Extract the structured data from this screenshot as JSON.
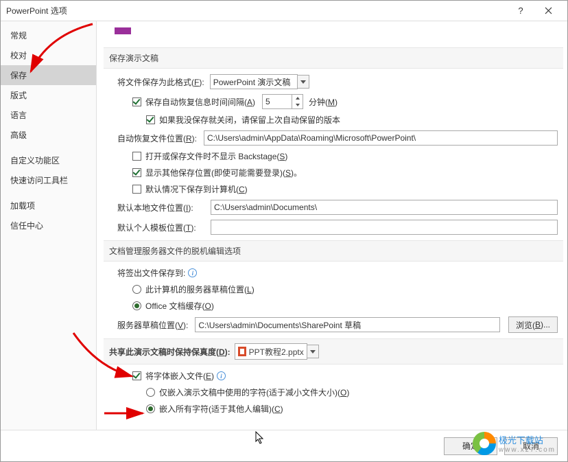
{
  "title": "PowerPoint 选项",
  "sidebar": {
    "items": [
      {
        "label": "常规"
      },
      {
        "label": "校对"
      },
      {
        "label": "保存"
      },
      {
        "label": "版式"
      },
      {
        "label": "语言"
      },
      {
        "label": "高级"
      },
      {
        "label": "自定义功能区"
      },
      {
        "label": "快速访问工具栏"
      },
      {
        "label": "加载项"
      },
      {
        "label": "信任中心"
      }
    ]
  },
  "sections": {
    "save_presentations": "保存演示文稿",
    "offline_docs": "文档管理服务器文件的脱机编辑选项",
    "fidelity_prefix": "共享此演示文稿时保持保真度(",
    "fidelity_d": "D",
    "fidelity_suffix": "):"
  },
  "labels": {
    "save_format_prefix": "将文件保存为此格式(",
    "save_format_f": "F",
    "save_format_suffix": "):",
    "format_value": "PowerPoint 演示文稿",
    "autorecover_prefix": "保存自动恢复信息时间间隔(",
    "autorecover_a": "A",
    "autorecover_suffix": ")",
    "autorecover_value": "5",
    "minutes_prefix": "分钟(",
    "minutes_m": "M",
    "minutes_suffix": ")",
    "keep_last_prefix": "如果我没保存就关闭，请保留上次自动保留的版本",
    "ar_location_prefix": "自动恢复文件位置(",
    "ar_location_r": "R",
    "ar_location_suffix": "):",
    "ar_location_value": "C:\\Users\\admin\\AppData\\Roaming\\Microsoft\\PowerPoint\\",
    "no_backstage_prefix": "打开或保存文件时不显示 Backstage(",
    "no_backstage_s": "S",
    "no_backstage_suffix": ")",
    "show_other_loc_prefix": "显示其他保存位置(即使可能需要登录)(",
    "show_other_loc_s": "S",
    "show_other_loc_suffix": ")。",
    "default_local_prefix": "默认情况下保存到计算机(",
    "default_local_c": "C",
    "default_local_suffix": ")",
    "default_file_loc_prefix": "默认本地文件位置(",
    "default_file_loc_i": "I",
    "default_file_loc_suffix": "):",
    "default_file_loc_value": "C:\\Users\\admin\\Documents\\",
    "default_tmpl_prefix": "默认个人模板位置(",
    "default_tmpl_t": "T",
    "default_tmpl_suffix": "):",
    "default_tmpl_value": "",
    "save_checkout_to": "将签出文件保存到:",
    "server_drafts_prefix": "此计算机的服务器草稿位置(",
    "server_drafts_l": "L",
    "server_drafts_suffix": ")",
    "office_cache_prefix": "Office 文档缓存(",
    "office_cache_o": "O",
    "office_cache_suffix": ")",
    "server_draft_loc_prefix": "服务器草稿位置(",
    "server_draft_loc_v": "V",
    "server_draft_loc_suffix": "):",
    "server_draft_loc_value": "C:\\Users\\admin\\Documents\\SharePoint 草稿",
    "browse_prefix": "浏览(",
    "browse_b": "B",
    "browse_suffix": ")...",
    "embed_fonts_prefix": "将字体嵌入文件(",
    "embed_fonts_e": "E",
    "embed_fonts_suffix": ")",
    "embed_used_prefix": "仅嵌入演示文稿中使用的字符(适于减小文件大小)(",
    "embed_used_o": "O",
    "embed_used_suffix": ")",
    "embed_all_prefix": "嵌入所有字符(适于其他人编辑)(",
    "embed_all_c": "C",
    "embed_all_suffix": ")",
    "file_value": "PPT教程2.pptx"
  },
  "footer": {
    "ok": "确定",
    "cancel": "取消"
  },
  "brand": {
    "name": "极光下载站",
    "sub": "www.xz7.com"
  }
}
